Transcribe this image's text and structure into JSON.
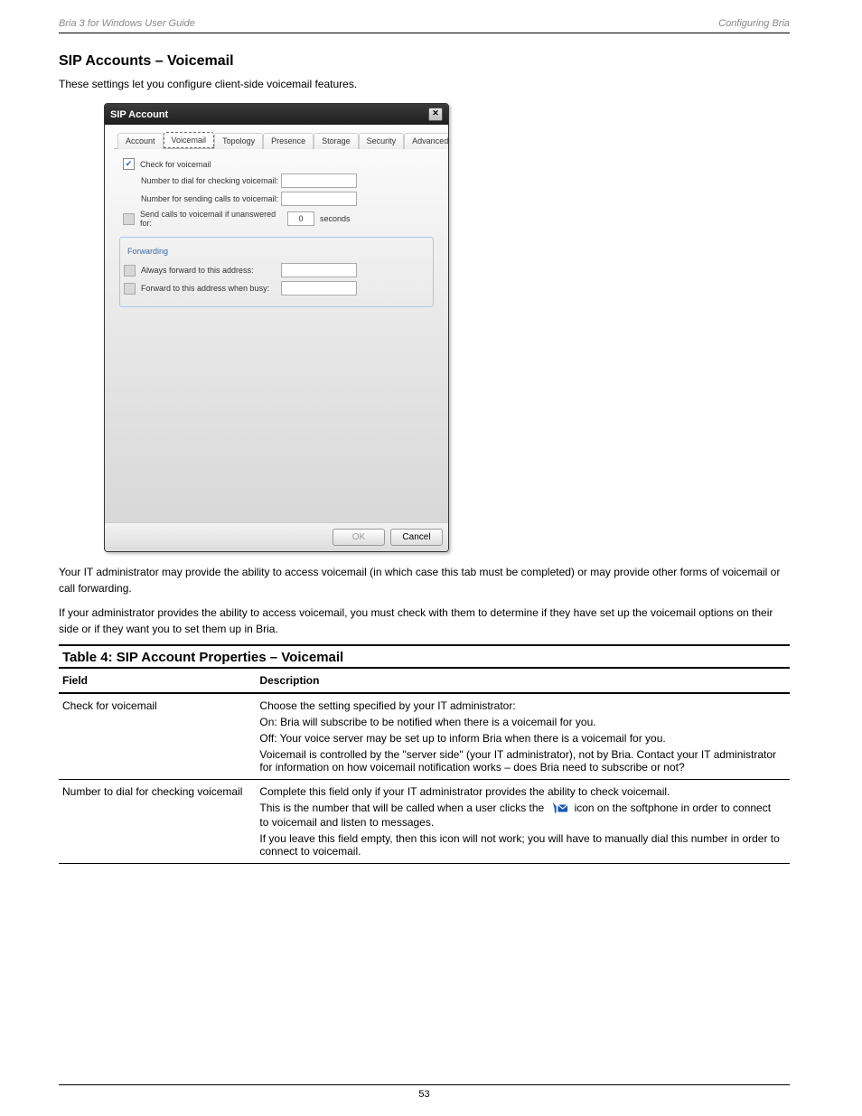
{
  "header": {
    "left": "Bria 3 for Windows User Guide",
    "right": "Configuring Bria"
  },
  "section_title": "SIP Accounts – Voicemail",
  "intro_text": "These settings let you configure client-side voicemail features.",
  "para2_1": "Your IT administrator may provide the ability to access voicemail (in which case this tab must be completed) or may provide other forms of voicemail or call forwarding.",
  "para3": "If your administrator provides the ability to access voicemail, you must check with them to determine if they have set up the voicemail options on their side or if they want you to set them up in Bria.",
  "dialog": {
    "title": "SIP Account",
    "tabs": [
      "Account",
      "Voicemail",
      "Topology",
      "Presence",
      "Storage",
      "Security",
      "Advanced"
    ],
    "active_tab_index": 1,
    "check_voicemail_label": "Check for voicemail",
    "dial_check_label": "Number to dial for checking voicemail:",
    "send_to_label": "Number for sending calls to voicemail:",
    "send_unanswered_label": "Send calls to voicemail if unanswered for:",
    "unanswered_value": "0",
    "seconds_label": "seconds",
    "forwarding_legend": "Forwarding",
    "always_forward_label": "Always forward to this address:",
    "forward_busy_label": "Forward to this address when busy:",
    "ok_label": "OK",
    "cancel_label": "Cancel"
  },
  "table": {
    "caption": "Table 4: SIP Account Properties – Voicemail",
    "col1": "Field",
    "col2": "Description",
    "rows": [
      {
        "field": "Check for voicemail",
        "desc_lines": [
          "Choose the setting specified by your IT administrator:",
          "On: Bria will subscribe to be notified when there is a voicemail for you.",
          "Off: Your voice server may be set up to inform Bria when there is a voicemail for you.",
          "Voicemail is controlled by the \"server side\" (your IT administrator), not by Bria. Contact your IT administrator for information on how voicemail notification works – does Bria need to subscribe or not?"
        ]
      },
      {
        "field": "Number to dial for checking voicemail",
        "desc_lines": [
          "Complete this field only if your IT administrator provides the ability to check voicemail.",
          "This is the number that will be called when a user clicks the  icon on the softphone in order to connect to voicemail and listen to messages.",
          "If you leave this field empty, then this icon will not work; you will have to manually dial this number in order to connect to voicemail."
        ]
      }
    ]
  },
  "footer_page": "53"
}
